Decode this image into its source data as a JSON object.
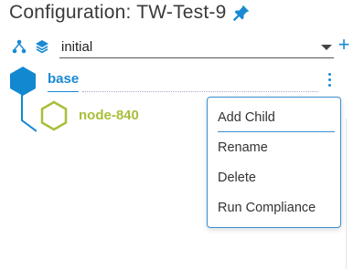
{
  "header": {
    "title": "Configuration: TW-Test-9",
    "pin_icon": "pin-icon"
  },
  "colors": {
    "accent": "#1a8ad4",
    "base_node": "#1288d0",
    "child_node": "#a8bf3a",
    "text": "#333333"
  },
  "toolbar": {
    "hierarchy_icon": "hierarchy-icon",
    "layers_icon": "layers-icon",
    "version_select": {
      "value": "initial"
    },
    "add_icon": "plus-icon",
    "add_label": "+"
  },
  "tree": {
    "root": {
      "label": "base",
      "icon": "hexagon-icon"
    },
    "children": [
      {
        "label": "node-840",
        "icon": "hexagon-outline-icon"
      }
    ]
  },
  "context_menu": {
    "items": [
      {
        "label": "Add Child"
      },
      {
        "label": "Rename"
      },
      {
        "label": "Delete"
      },
      {
        "label": "Run Compliance"
      }
    ]
  }
}
